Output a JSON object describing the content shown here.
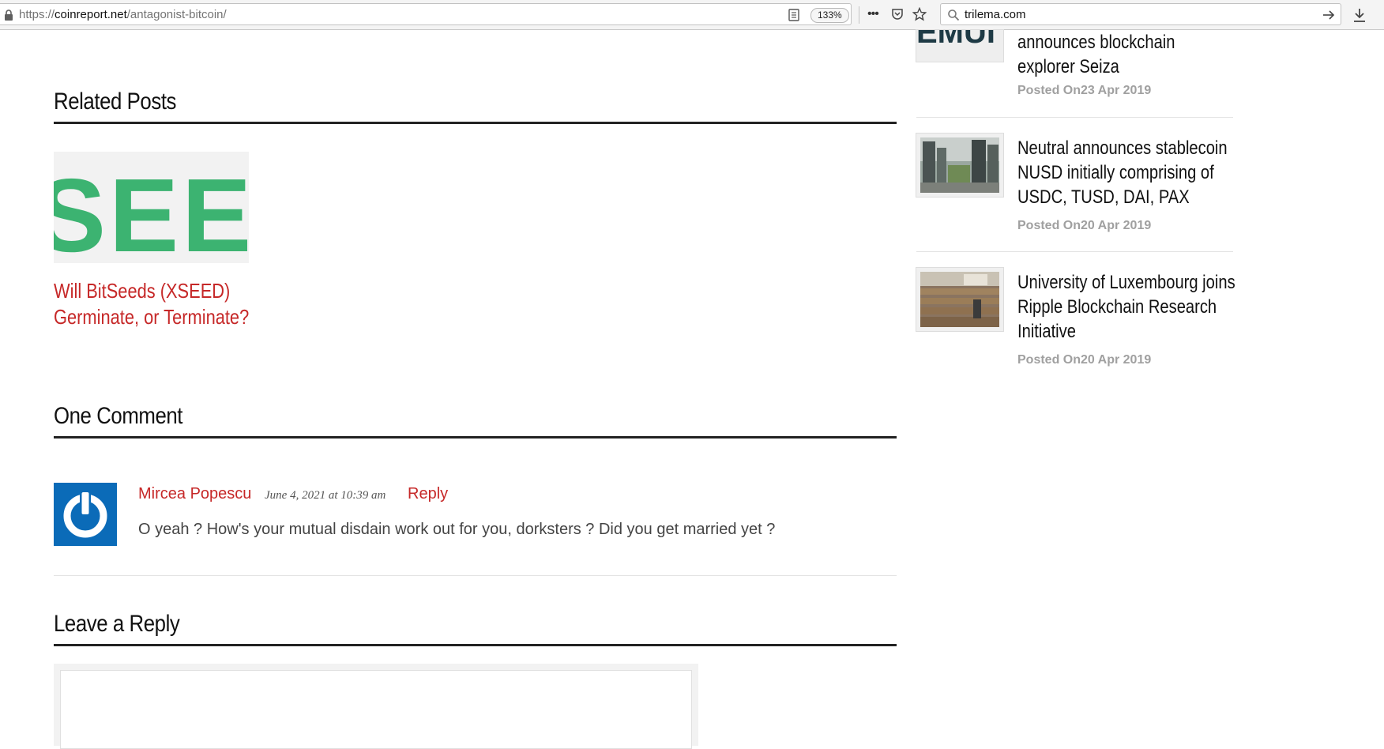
{
  "browser": {
    "url_prefix": "https://",
    "url_host": "coinreport.net",
    "url_path": "/antagonist-bitcoin/",
    "zoom": "133%",
    "more_glyph": "•••",
    "search_query": "trilema.com"
  },
  "main": {
    "related_heading": "Related Posts",
    "related_post": {
      "thumb_text": "SEED",
      "title": "Will BitSeeds (XSEED) Germinate, or Terminate?"
    },
    "comments_heading": "One Comment",
    "comment": {
      "author": "Mircea Popescu",
      "date": "June 4, 2021  at 10:39 am",
      "reply_label": "Reply",
      "text": "O yeah ? How's your mutual disdain work out for you, dorksters ? Did you get married yet ?"
    },
    "leave_reply_heading": "Leave a Reply"
  },
  "sidebar": {
    "items": [
      {
        "thumb_text": "EMUI",
        "title": "announces blockchain explorer Seiza",
        "date": "Posted On23 Apr 2019"
      },
      {
        "title": "Neutral announces stablecoin NUSD initially comprising of USDC, TUSD, DAI, PAX",
        "date": "Posted On20 Apr 2019"
      },
      {
        "title": "University of Luxembourg joins Ripple Blockchain Research Initiative",
        "date": "Posted On20 Apr 2019"
      }
    ]
  },
  "colors": {
    "accent_red": "#c62828",
    "seed_green": "#3cb371",
    "avatar_blue": "#0b6bb8"
  }
}
